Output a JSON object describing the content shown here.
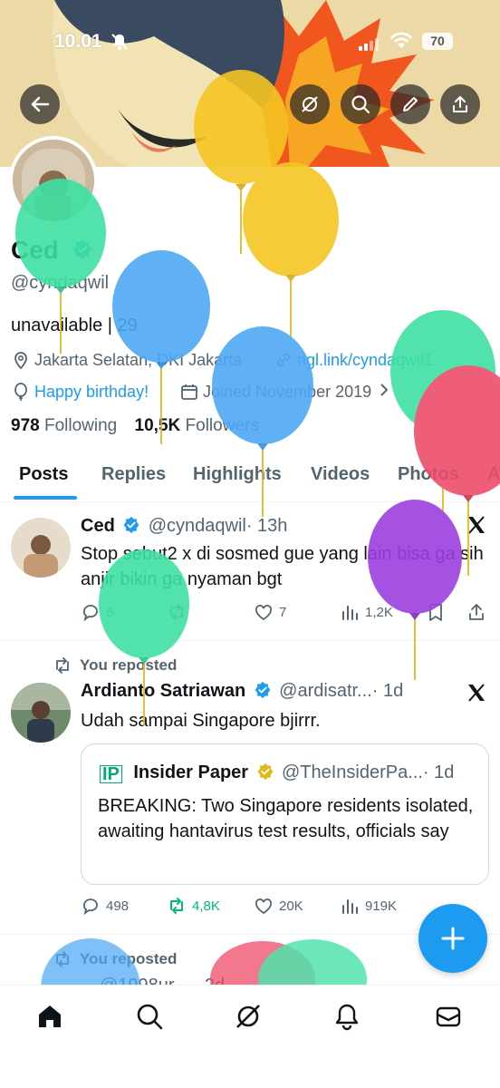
{
  "status_bar": {
    "time": "10.01",
    "battery": "70"
  },
  "profile": {
    "name": "Ced",
    "handle": "@cyndaqwil",
    "bio": "unavailable | 29",
    "location": "Jakarta Selatan, DKI Jakarta",
    "website": "ngl.link/cyndaqwil1",
    "birthday": "Happy birthday!",
    "joined": "Joined November 2019",
    "following_count": "978",
    "following_label": "Following",
    "followers_count": "10,5K",
    "followers_label": "Followers"
  },
  "tabs": [
    "Posts",
    "Replies",
    "Highlights",
    "Videos",
    "Photos",
    "A"
  ],
  "tweets": [
    {
      "name": "Ced",
      "handle": "@cyndaqwil",
      "time": "· 13h",
      "text": "Stop sebut2 x di sosmed gue yang lain bisa ga sih anjir bikin ga nyaman bgt",
      "replies": "6",
      "reposts": "",
      "likes": "7",
      "views": "1,2K"
    },
    {
      "repost_label": "You reposted",
      "name": "Ardianto Satriawan",
      "handle": "@ardisatr...",
      "time": "· 1d",
      "text": "Udah sampai Singapore bjirrr.",
      "quote": {
        "name": "Insider Paper",
        "handle": "@TheInsiderPa...",
        "time": "· 1d",
        "text": "BREAKING: Two Singapore residents isolated, awaiting hantavirus test results, officials say"
      },
      "replies": "498",
      "reposts": "4,8K",
      "likes": "20K",
      "views": "919K"
    },
    {
      "repost_label": "You reposted",
      "handle": "@1998ur...",
      "time": "· 2d"
    }
  ],
  "colors": {
    "accent": "#1d9bf0",
    "text": "#0f1419",
    "secondary": "#536471",
    "repost_green": "#00ba7c",
    "verified_gold": "#e2b719"
  },
  "icons": [
    "back-arrow-icon",
    "grok-icon",
    "search-icon",
    "edit-icon",
    "share-icon",
    "verified-icon",
    "x-logo-icon",
    "home-icon",
    "notifications-icon",
    "messages-icon"
  ]
}
